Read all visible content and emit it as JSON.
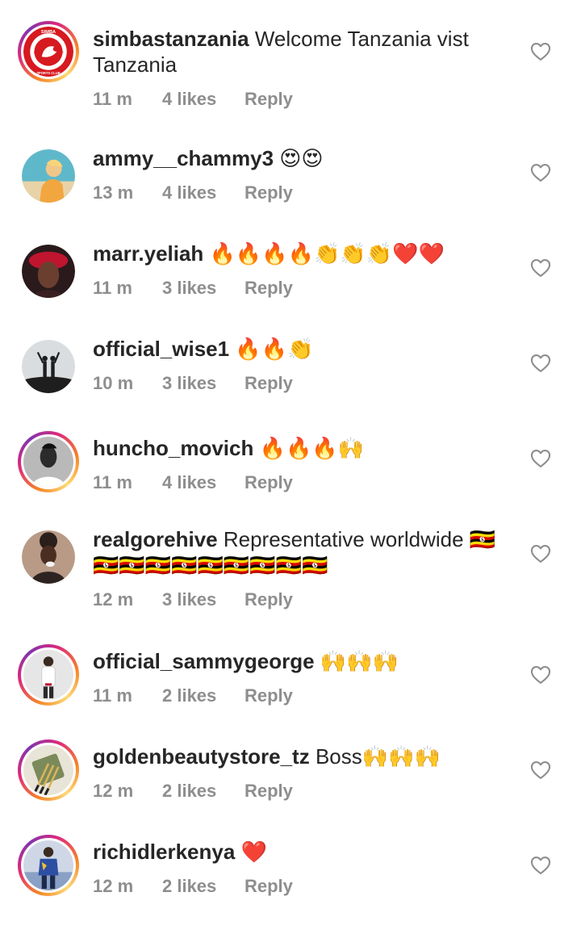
{
  "comments": [
    {
      "username": "simbastanzania",
      "text": " Welcome Tanzania vist Tanzania",
      "time": "11 m",
      "likes": "4 likes",
      "reply": "Reply",
      "avatar": {
        "type": "club-logo",
        "color": "#d71920",
        "ring": "story",
        "logo_text_top": "SIMBA",
        "logo_text_bottom": "SPORTS CLUB",
        "logo_year_left": "19",
        "logo_year_right": "36"
      }
    },
    {
      "username": "ammy__chammy3",
      "text": " 😍😍",
      "time": "13 m",
      "likes": "4 likes",
      "reply": "Reply",
      "avatar": {
        "type": "photo",
        "color": "#5fb8c9",
        "ring": "plain"
      }
    },
    {
      "username": "marr.yeliah",
      "text": " 🔥🔥🔥🔥👏👏👏❤️❤️",
      "time": "11 m",
      "likes": "3 likes",
      "reply": "Reply",
      "avatar": {
        "type": "photo",
        "color": "#c0152f",
        "ring": "plain"
      }
    },
    {
      "username": "official_wise1",
      "text": " 🔥🔥👏",
      "time": "10 m",
      "likes": "3 likes",
      "reply": "Reply",
      "avatar": {
        "type": "photo",
        "color": "#d9dde0",
        "ring": "plain"
      }
    },
    {
      "username": "huncho_movich",
      "text": " 🔥🔥🔥🙌",
      "time": "11 m",
      "likes": "4 likes",
      "reply": "Reply",
      "avatar": {
        "type": "photo",
        "color": "#b9b9b9",
        "ring": "story"
      }
    },
    {
      "username": "realgorehive",
      "text": " Representative worldwide 🇺🇬🇺🇬🇺🇬🇺🇬🇺🇬🇺🇬🇺🇬🇺🇬🇺🇬🇺🇬",
      "time": "12 m",
      "likes": "3 likes",
      "reply": "Reply",
      "avatar": {
        "type": "photo",
        "color": "#b89a86",
        "ring": "plain"
      }
    },
    {
      "username": "official_sammygeorge",
      "text": " 🙌🙌🙌",
      "time": "11 m",
      "likes": "2 likes",
      "reply": "Reply",
      "avatar": {
        "type": "photo",
        "color": "#e6e6e6",
        "ring": "story"
      }
    },
    {
      "username": "goldenbeautystore_tz",
      "text": " Boss🙌🙌🙌",
      "time": "12 m",
      "likes": "2 likes",
      "reply": "Reply",
      "avatar": {
        "type": "photo",
        "color": "#7b8a5a",
        "ring": "story"
      }
    },
    {
      "username": "richidlerkenya",
      "text": " ❤️",
      "time": "12 m",
      "likes": "2 likes",
      "reply": "Reply",
      "avatar": {
        "type": "photo",
        "color": "#cfd7e6",
        "ring": "story"
      }
    }
  ],
  "icons": {
    "like": "heart-outline-icon"
  },
  "colors": {
    "text": "#262626",
    "meta": "#8e8e8e",
    "heart_outline": "#8e8e8e"
  }
}
